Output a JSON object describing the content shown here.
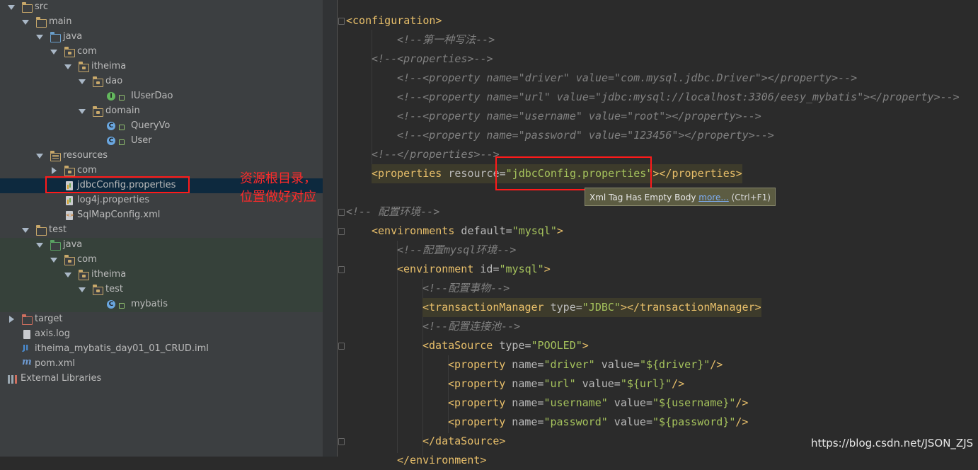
{
  "tree": {
    "items": [
      {
        "label": "src",
        "icon": "folder-icon"
      },
      {
        "label": "main",
        "icon": "folder-icon"
      },
      {
        "label": "java",
        "icon": "source-folder-icon"
      },
      {
        "label": "com",
        "icon": "package-icon"
      },
      {
        "label": "itheima",
        "icon": "package-icon"
      },
      {
        "label": "dao",
        "icon": "package-icon"
      },
      {
        "label": "IUserDao",
        "icon": "interface-icon"
      },
      {
        "label": "domain",
        "icon": "package-icon"
      },
      {
        "label": "QueryVo",
        "icon": "class-icon"
      },
      {
        "label": "User",
        "icon": "class-icon"
      },
      {
        "label": "resources",
        "icon": "resources-folder-icon"
      },
      {
        "label": "com",
        "icon": "package-icon"
      },
      {
        "label": "jdbcConfig.properties",
        "icon": "properties-file-icon"
      },
      {
        "label": "log4j.properties",
        "icon": "properties-file-icon"
      },
      {
        "label": "SqlMapConfig.xml",
        "icon": "xml-file-icon"
      },
      {
        "label": "test",
        "icon": "folder-icon"
      },
      {
        "label": "java",
        "icon": "test-folder-icon"
      },
      {
        "label": "com",
        "icon": "package-icon"
      },
      {
        "label": "itheima",
        "icon": "package-icon"
      },
      {
        "label": "test",
        "icon": "package-icon"
      },
      {
        "label": "mybatis",
        "icon": "test-class-icon"
      },
      {
        "label": "target",
        "icon": "excluded-folder-icon"
      },
      {
        "label": "axis.log",
        "icon": "text-file-icon"
      },
      {
        "label": "itheima_mybatis_day01_01_CRUD.iml",
        "icon": "iml-file-icon"
      },
      {
        "label": "pom.xml",
        "icon": "maven-icon"
      },
      {
        "label": "External Libraries",
        "icon": "libraries-icon"
      }
    ],
    "badges": {
      "interface": "I",
      "class": "C",
      "iml": "JI",
      "maven": "m"
    }
  },
  "annotation": {
    "note_line1": "资源根目录，",
    "note_line2": "位置做好对应"
  },
  "code": {
    "l1_tag": "<configuration>",
    "l2": "<!--第一种写法-->",
    "l3": "<!--<properties>-->",
    "l4": "<!--<property name=\"driver\" value=\"com.mysql.jdbc.Driver\"></property>-->",
    "l5": "<!--<property name=\"url\" value=\"jdbc:mysql://localhost:3306/eesy_mybatis\"></property>-->",
    "l6": "<!--<property name=\"username\" value=\"root\"></property>-->",
    "l7": "<!--<property name=\"password\" value=\"123456\"></property>-->",
    "l8": "<!--</properties>-->",
    "l9_open": "<properties",
    "l9_attr": " resource=",
    "l9_val": "\"jdbcConfig.properties\"",
    "l9_close": "></properties>",
    "l10": "<!-- 配置环境-->",
    "l11_open": "<environments",
    "l11_attr": " default=",
    "l11_val": "\"mysql\"",
    "l11_close": ">",
    "l12": "<!--配置mysql环境-->",
    "l13_open": "<environment",
    "l13_attr": " id=",
    "l13_val": "\"mysql\"",
    "l13_close": ">",
    "l14": "<!--配置事物-->",
    "l15_open": "<transactionManager",
    "l15_attr": " type=",
    "l15_val": "\"JDBC\"",
    "l15_close": "></transactionManager>",
    "l16": "<!--配置连接池-->",
    "l17_open": "<dataSource",
    "l17_attr": " type=",
    "l17_val": "\"POOLED\"",
    "l17_close": ">",
    "p_open": "<property",
    "p_name_attr": " name=",
    "p_value_attr": " value=",
    "p_close": "/>",
    "props": [
      {
        "name": "\"driver\"",
        "value": "\"${driver}\""
      },
      {
        "name": "\"url\"",
        "value": "\"${url}\""
      },
      {
        "name": "\"username\"",
        "value": "\"${username}\""
      },
      {
        "name": "\"password\"",
        "value": "\"${password}\""
      }
    ],
    "l22": "</dataSource>",
    "l23": "</environment>"
  },
  "tooltip": {
    "message": "Xml Tag Has Empty Body ",
    "link": "more...",
    "shortcut": " (Ctrl+F1)"
  },
  "watermark": "https://blog.csdn.net/JSON_ZJS"
}
